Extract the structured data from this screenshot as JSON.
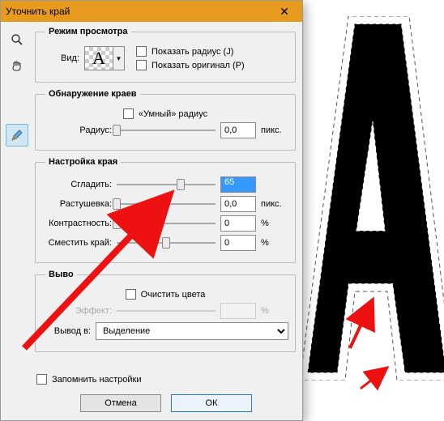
{
  "title": "Уточнить край",
  "sections": {
    "view_mode": {
      "legend": "Режим просмотра",
      "view_label": "Вид:",
      "thumb_letter": "A",
      "show_radius": "Показать радиус (J)",
      "show_original": "Показать оригинал (P)"
    },
    "edge_detect": {
      "legend": "Обнаружение краев",
      "smart_radius": "«Умный» радиус",
      "radius_label": "Радиус:",
      "radius_value": "0,0",
      "radius_unit": "пикс."
    },
    "edge_adjust": {
      "legend": "Настройка края",
      "smooth_label": "Сгладить:",
      "smooth_value": "65",
      "feather_label": "Растушевка:",
      "feather_value": "0,0",
      "feather_unit": "пикс.",
      "contrast_label": "Контрастность:",
      "contrast_value": "0",
      "contrast_unit": "%",
      "shift_label": "Сместить край:",
      "shift_value": "0",
      "shift_unit": "%"
    },
    "output": {
      "legend": "Выво",
      "decontaminate": "Очистить цвета",
      "effect_label": "Эффект:",
      "effect_unit": "%",
      "output_label": "Вывод в:",
      "output_value": "Выделение"
    }
  },
  "remember": "Запомнить настройки",
  "buttons": {
    "cancel": "Отмена",
    "ok": "ОК"
  }
}
